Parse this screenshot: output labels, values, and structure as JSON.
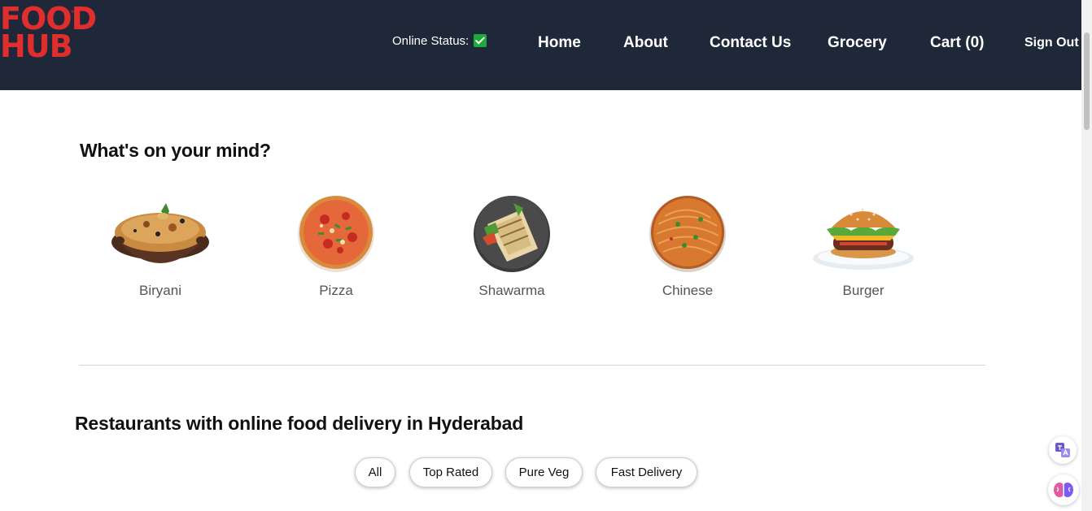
{
  "brand": {
    "line1": "FOOD",
    "line2": "HUB",
    "tm": "™",
    "color": "#e02d2d"
  },
  "header": {
    "online_status_label": "Online Status:",
    "nav": {
      "home": "Home",
      "about": "About",
      "contact": "Contact Us",
      "grocery": "Grocery",
      "cart": "Cart (0)",
      "signout": "Sign Out"
    }
  },
  "mind": {
    "title": "What's on your mind?",
    "categories": [
      {
        "label": "Biryani",
        "icon": "biryani-icon"
      },
      {
        "label": "Pizza",
        "icon": "pizza-icon"
      },
      {
        "label": "Shawarma",
        "icon": "shawarma-icon"
      },
      {
        "label": "Chinese",
        "icon": "chinese-icon"
      },
      {
        "label": "Burger",
        "icon": "burger-icon"
      }
    ]
  },
  "restaurants": {
    "title": "Restaurants with online food delivery in Hyderabad",
    "filters": [
      "All",
      "Top Rated",
      "Pure Veg",
      "Fast Delivery"
    ]
  },
  "colors": {
    "header_bg": "#1e2839",
    "status_green": "#1fa83b"
  }
}
